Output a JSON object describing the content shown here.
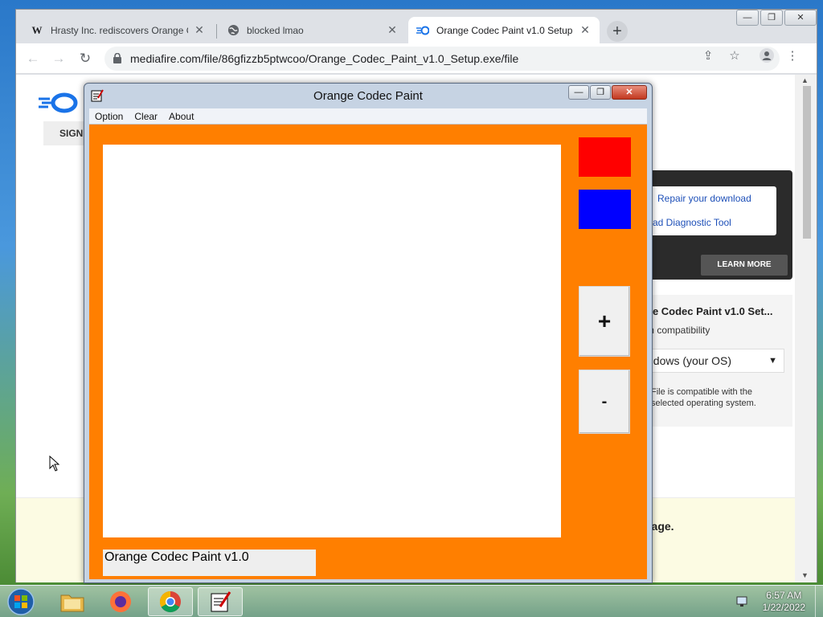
{
  "browser": {
    "tabs": [
      {
        "icon": "wikipedia-icon",
        "title": "Hrasty Inc. rediscovers Orange Co",
        "active": false
      },
      {
        "icon": "globe-icon",
        "title": "blocked lmao",
        "active": false
      },
      {
        "icon": "mediafire-icon",
        "title": "Orange Codec Paint v1.0 Setup",
        "active": true
      }
    ],
    "url": "mediafire.com/file/86gfizzb5ptwcoo/Orange_Codec_Paint_v1.0_Setup.exe/file",
    "window_controls": {
      "minimize": "—",
      "restore": "❐",
      "close": "✕"
    }
  },
  "page": {
    "sign_button": "SIGN",
    "links": [
      "Repair your download",
      "ad Diagnostic Tool"
    ],
    "learn_more": "LEARN MORE",
    "file_title": "ge Codec Paint v1.0 Set...",
    "compat_label": "m compatibility",
    "os_select": "ndows (your OS)",
    "compat_note": "File is compatible with the selected operating system.",
    "banner_text": "page."
  },
  "paint_window": {
    "title": "Orange Codec Paint",
    "menu": [
      "Option",
      "Clear",
      "About"
    ],
    "plus_label": "+",
    "minus_label": "-",
    "status": "Orange Codec Paint v1.0",
    "colors": {
      "background": "#ff7f00",
      "swatch_red": "#ff0000",
      "swatch_blue": "#0000ff"
    }
  },
  "taskbar": {
    "time": "6:57 AM",
    "date": "1/22/2022"
  }
}
